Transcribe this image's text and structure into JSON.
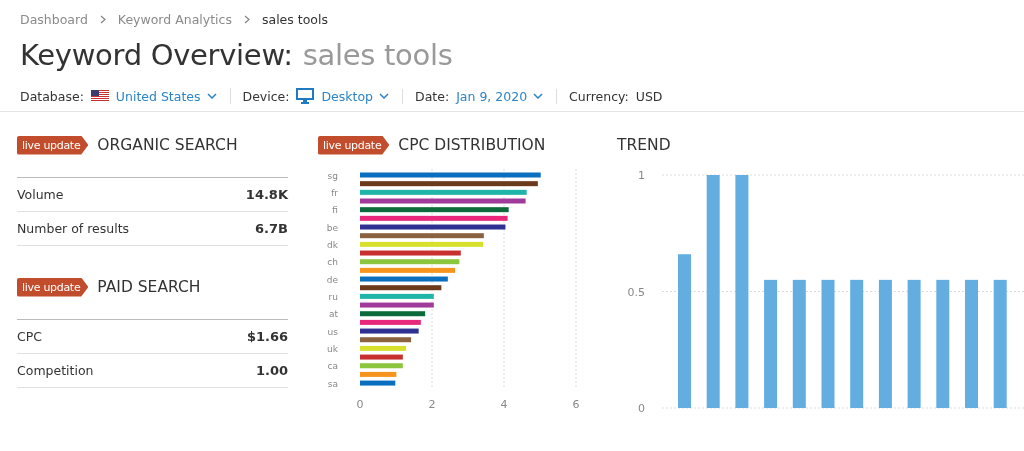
{
  "breadcrumb": [
    {
      "label": "Dashboard",
      "current": false
    },
    {
      "label": "Keyword Analytics",
      "current": false
    },
    {
      "label": "sales tools",
      "current": true
    }
  ],
  "title": {
    "main": "Keyword Overview:",
    "keyword": "sales tools"
  },
  "filters": [
    {
      "kind": "flag",
      "label": "Database:",
      "value": "United States",
      "dropdown": true
    },
    {
      "kind": "monitor",
      "label": "Device:",
      "value": "Desktop",
      "dropdown": true
    },
    {
      "kind": "plain",
      "label": "Date:",
      "value": "Jan 9, 2020",
      "dropdown": true
    },
    {
      "kind": "plain",
      "label": "Currency:",
      "value": "USD",
      "dropdown": false
    }
  ],
  "sections": [
    {
      "badge": "live update",
      "title": "ORGANIC SEARCH",
      "rows": [
        {
          "label": "Volume",
          "value": "14.8K"
        },
        {
          "label": "Number of results",
          "value": "6.7B"
        }
      ]
    },
    {
      "badge": "live update",
      "title": "PAID SEARCH",
      "rows": [
        {
          "label": "CPC",
          "value": "$1.66"
        },
        {
          "label": "Competition",
          "value": "1.00"
        }
      ]
    }
  ],
  "cpc_distribution": {
    "badge": "live update",
    "chart_data": {
      "type": "bar",
      "title": "CPC DISTRIBUTION",
      "orientation": "horizontal",
      "values": [
        5.02,
        4.94,
        4.63,
        4.6,
        4.13,
        4.1,
        4.04,
        3.44,
        3.42,
        2.8,
        2.76,
        2.64,
        2.44,
        2.26,
        2.05,
        2.05,
        1.81,
        1.69,
        1.63,
        1.42,
        1.28,
        1.19,
        1.19,
        1.01,
        0.98
      ],
      "colors": [
        "#0b6fc0",
        "#6b3a1a",
        "#1fb5a8",
        "#a03a9b",
        "#0b6b3a",
        "#e8287a",
        "#2e3192",
        "#8b6240",
        "#d7e02c",
        "#c8302f",
        "#8cc63f",
        "#f7941d",
        "#0b6fc0",
        "#6b3a1a",
        "#1fb5a8",
        "#a03a9b",
        "#0b6b3a",
        "#e8287a",
        "#2e3192",
        "#8b6240",
        "#d7e02c",
        "#c8302f",
        "#8cc63f",
        "#f7941d",
        "#0b6fc0"
      ],
      "categories": [
        "sg",
        null,
        "fr",
        null,
        "fi",
        null,
        "be",
        null,
        "dk",
        null,
        "ch",
        null,
        "de",
        null,
        "ru",
        null,
        "at",
        null,
        "us",
        null,
        "uk",
        null,
        "ca",
        null,
        "sa"
      ],
      "xlim": [
        0,
        6
      ],
      "xticks": [
        0,
        2,
        4,
        6
      ]
    }
  },
  "trend": {
    "chart_data": {
      "type": "bar",
      "title": "TREND",
      "series": [
        {
          "color": "#63ade0",
          "values": [
            0.66,
            1,
            1,
            0.55,
            0.55,
            0.55,
            0.55,
            0.55,
            0.55,
            0.55,
            0.55,
            0.55
          ]
        }
      ],
      "ylim": [
        0,
        1
      ],
      "yticks": [
        0,
        0.5,
        1
      ]
    }
  }
}
